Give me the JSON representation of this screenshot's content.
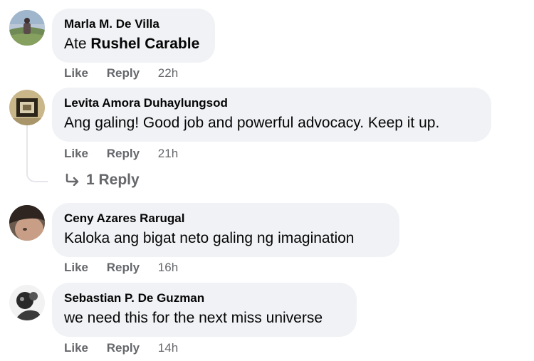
{
  "comments": [
    {
      "author": "Marla M. De Villa",
      "text_prefix": "Ate ",
      "mention": "Rushel Carable",
      "text": "",
      "like": "Like",
      "reply": "Reply",
      "time": "22h"
    },
    {
      "author": "Levita Amora Duhaylungsod",
      "text": "Ang galing! Good job and powerful advocacy. Keep it up.",
      "like": "Like",
      "reply": "Reply",
      "time": "21h",
      "replies_label": "1 Reply"
    },
    {
      "author": "Ceny Azares Rarugal",
      "text": "Kaloka ang bigat neto galing ng imagination",
      "like": "Like",
      "reply": "Reply",
      "time": "16h"
    },
    {
      "author": "Sebastian P. De Guzman",
      "text": "we need this for the next miss universe",
      "like": "Like",
      "reply": "Reply",
      "time": "14h"
    }
  ],
  "icons": {
    "reply_arrow": "reply-arrow-icon"
  },
  "colors": {
    "bubble_bg": "#f0f2f5",
    "secondary_text": "#65676b",
    "primary_text": "#050505"
  }
}
